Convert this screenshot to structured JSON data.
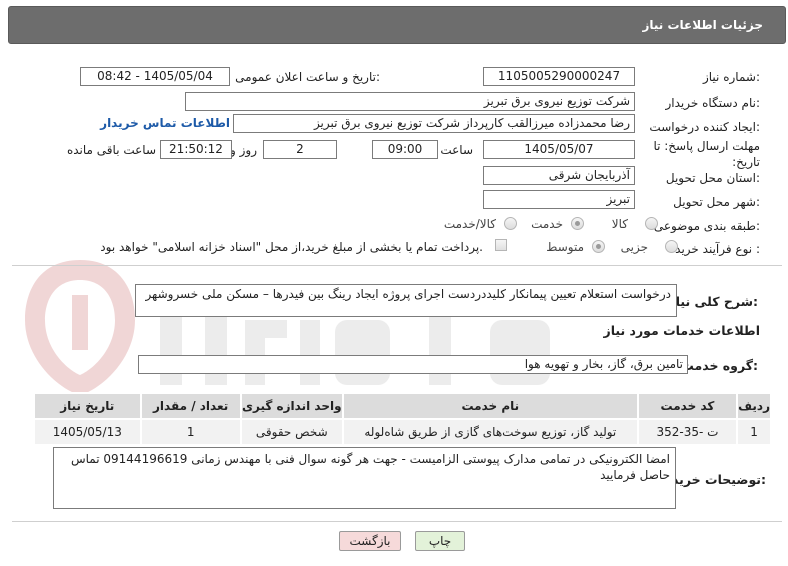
{
  "header": {
    "title": "جزئیات اطلاعات نیاز"
  },
  "need_number": {
    "label": "شماره نیاز:",
    "value": "1105005290000247"
  },
  "announce": {
    "label": "تاریخ و ساعت اعلان عمومی:",
    "value": "1405/05/04 - 08:42"
  },
  "buyer": {
    "label": "نام دستگاه خریدار:",
    "value": "شرکت توزیع نیروی برق تبریز"
  },
  "creator": {
    "label": "ایجاد کننده درخواست:",
    "value": "رضا محمدزاده میرزالقب کارپرداز شرکت توزیع نیروی برق تبریز",
    "contact_link": "اطلاعات تماس خریدار"
  },
  "deadline": {
    "label": "مهلت ارسال پاسخ: تا تاریخ:",
    "date": "1405/05/07",
    "time_label": "ساعت",
    "time": "09:00",
    "days": "2",
    "days_label": "روز و",
    "remaining": "21:50:12",
    "remaining_label": "ساعت باقی مانده"
  },
  "province": {
    "label": "استان محل تحویل:",
    "value": "آذربایجان شرقی"
  },
  "city": {
    "label": "شهر محل تحویل:",
    "value": "تبریز"
  },
  "category": {
    "label": "طبقه بندی موضوعی:",
    "options": [
      "کالا",
      "خدمت",
      "کالا/خدمت"
    ],
    "selected": "خدمت"
  },
  "process": {
    "label": "نوع فرآیند خرید :",
    "options": [
      "جزیی",
      "متوسط"
    ],
    "selected": "متوسط",
    "payment_note": "پرداخت تمام یا بخشی از مبلغ خرید،از محل \"اسناد خزانه اسلامی\" خواهد بود."
  },
  "summary": {
    "label": "شرح کلی نیاز:",
    "value": "درخواست استعلام تعیین پیمانکار کلیددردست اجرای پروژه ایجاد رینگ بین فیدرها – مسکن ملی خسروشهر"
  },
  "services_title": "اطلاعات خدمات مورد نیاز",
  "service_group": {
    "label": "گروه خدمت:",
    "value": "تامین برق، گاز، بخار و تهویه هوا"
  },
  "table": {
    "headers": [
      "ردیف",
      "کد خدمت",
      "نام خدمت",
      "واحد اندازه گیری",
      "تعداد / مقدار",
      "تاریخ نیاز"
    ],
    "rows": [
      [
        "1",
        "ت -35-352",
        "تولید گاز، توزیع سوخت‌های گازی از طریق شاه‌لوله",
        "شخص حقوقی",
        "1",
        "1405/05/13"
      ]
    ]
  },
  "buyer_notes": {
    "label": "توضیحات خریدار:",
    "value": "امضا الکترونیکی در تمامی مدارک پیوستی الزامیست - جهت هر گونه سوال فنی با مهندس زمانی 09144196619 تماس حاصل فرمایید"
  },
  "buttons": {
    "print": "چاپ",
    "back": "بازگشت"
  },
  "colors": {
    "header_bg": "#6d6d6d",
    "link": "#1d5aa8",
    "print_bg": "#e3f2d9",
    "back_bg": "#f6dada"
  }
}
